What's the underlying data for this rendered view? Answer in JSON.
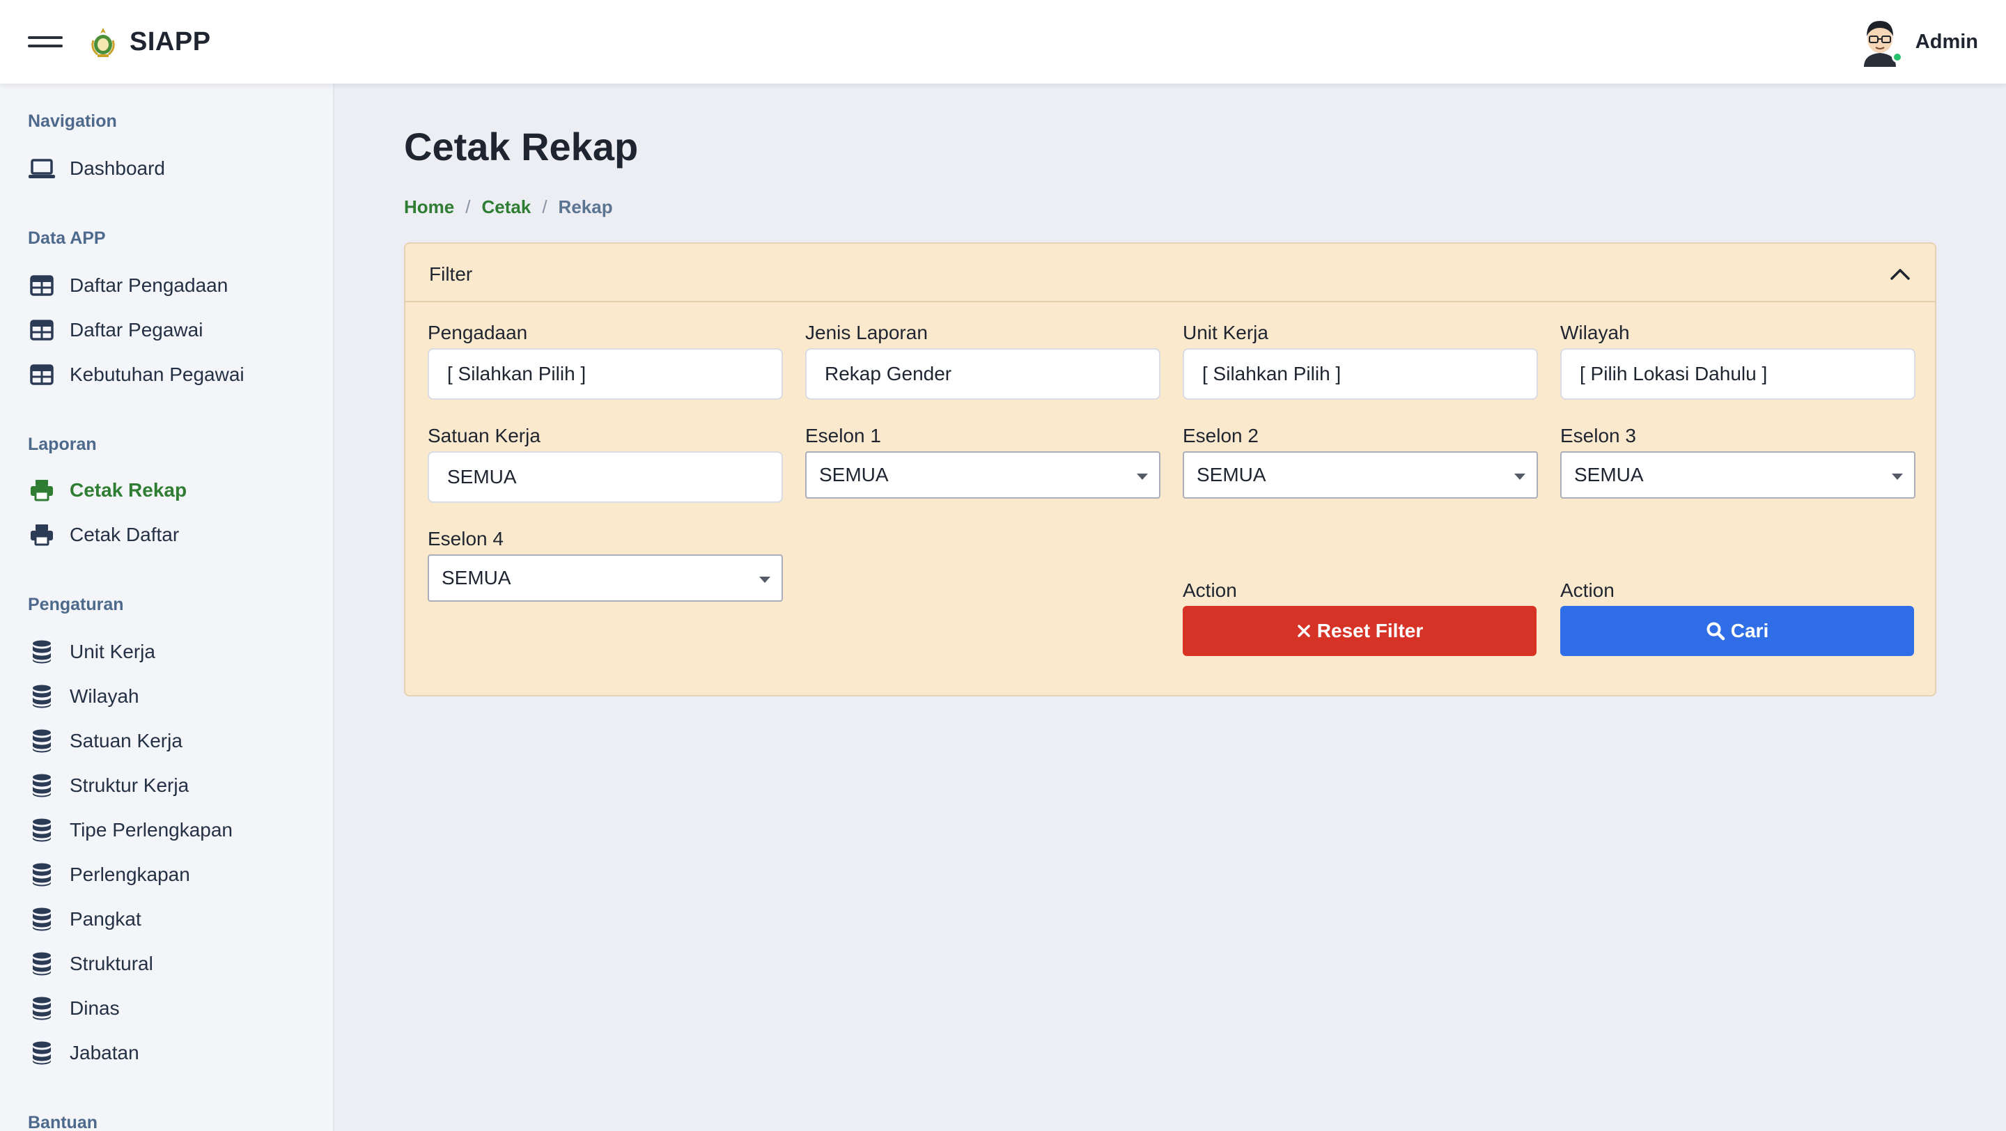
{
  "app": {
    "name": "SIAPP"
  },
  "user": {
    "name": "Admin"
  },
  "sidebar": {
    "sections": [
      {
        "title": "Navigation",
        "items": [
          {
            "label": "Dashboard",
            "icon": "laptop-icon"
          }
        ]
      },
      {
        "title": "Data APP",
        "items": [
          {
            "label": "Daftar Pengadaan",
            "icon": "table-icon"
          },
          {
            "label": "Daftar Pegawai",
            "icon": "table-icon"
          },
          {
            "label": "Kebutuhan Pegawai",
            "icon": "table-icon"
          }
        ]
      },
      {
        "title": "Laporan",
        "items": [
          {
            "label": "Cetak Rekap",
            "icon": "printer-icon",
            "active": true
          },
          {
            "label": "Cetak Daftar",
            "icon": "printer-icon"
          }
        ]
      },
      {
        "title": "Pengaturan",
        "items": [
          {
            "label": "Unit Kerja",
            "icon": "database-icon"
          },
          {
            "label": "Wilayah",
            "icon": "database-icon"
          },
          {
            "label": "Satuan Kerja",
            "icon": "database-icon"
          },
          {
            "label": "Struktur Kerja",
            "icon": "database-icon"
          },
          {
            "label": "Tipe Perlengkapan",
            "icon": "database-icon"
          },
          {
            "label": "Perlengkapan",
            "icon": "database-icon"
          },
          {
            "label": "Pangkat",
            "icon": "database-icon"
          },
          {
            "label": "Struktural",
            "icon": "database-icon"
          },
          {
            "label": "Dinas",
            "icon": "database-icon"
          },
          {
            "label": "Jabatan",
            "icon": "database-icon"
          }
        ]
      },
      {
        "title": "Bantuan",
        "items": []
      }
    ]
  },
  "page": {
    "title": "Cetak Rekap",
    "breadcrumb": {
      "home": "Home",
      "parent": "Cetak",
      "current": "Rekap",
      "separator": "/"
    }
  },
  "filter": {
    "title": "Filter",
    "pengadaan": {
      "label": "Pengadaan",
      "value": "[ Silahkan Pilih ]"
    },
    "jenis_laporan": {
      "label": "Jenis Laporan",
      "value": "Rekap Gender"
    },
    "unit_kerja": {
      "label": "Unit Kerja",
      "value": "[ Silahkan Pilih ]"
    },
    "wilayah": {
      "label": "Wilayah",
      "value": "[ Pilih Lokasi Dahulu ]"
    },
    "satuan_kerja": {
      "label": "Satuan Kerja",
      "value": "SEMUA"
    },
    "eselon1": {
      "label": "Eselon 1",
      "value": "SEMUA"
    },
    "eselon2": {
      "label": "Eselon 2",
      "value": "SEMUA"
    },
    "eselon3": {
      "label": "Eselon 3",
      "value": "SEMUA"
    },
    "eselon4": {
      "label": "Eselon 4",
      "value": "SEMUA"
    },
    "action_label": "Action",
    "reset_label": "Reset Filter",
    "search_label": "Cari"
  },
  "colors": {
    "accent_green": "#2e7d32",
    "filter_bg": "#fbe9cd",
    "reset_red": "#d63226",
    "search_blue": "#2f6ee6"
  }
}
